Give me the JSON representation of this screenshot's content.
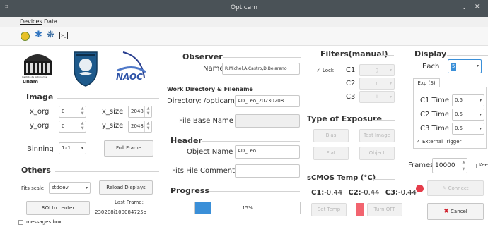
{
  "window": {
    "title": "Opticam"
  },
  "menu": {
    "devices": "Devices",
    "data": "Data"
  },
  "logos": {
    "unam": "unam",
    "unam_sub": "Instituto de Astronomía",
    "naoc": "NAOC"
  },
  "image": {
    "title": "Image",
    "x_org_label": "x_org",
    "x_org_value": "0",
    "y_org_label": "y_org",
    "y_org_value": "0",
    "x_size_label": "x_size",
    "x_size_value": "2048",
    "y_size_label": "y_size",
    "y_size_value": "2048",
    "binning_label": "Binning",
    "binning_value": "1x1",
    "full_frame_button": "Full Frame"
  },
  "others": {
    "title": "Others",
    "fits_scale_label": "Fits scale",
    "fits_scale_value": "stddev",
    "reload_button": "Reload Displays",
    "roi_button": "ROI to center",
    "last_frame_label": "Last Frame:",
    "last_frame_value": "230208i100084725o",
    "messages_box_label": "messages box"
  },
  "observer": {
    "title": "Observer",
    "name_label": "Name",
    "name_value": "R.Michel,A.Castro,D.Bejarano"
  },
  "workdir": {
    "title": "Work Directory & Filename",
    "directory_label": "Directory: /opticam/",
    "directory_value": "AD_Leo_20230208",
    "basename_label": "File Base Name",
    "basename_value": ""
  },
  "header": {
    "title": "Header",
    "object_label": "Object Name",
    "object_value": "AD_Leo",
    "comment_label": "Fits File Comment",
    "comment_value": ""
  },
  "progress": {
    "title": "Progress",
    "value": 15,
    "text": "15%"
  },
  "filters": {
    "title": "Filters(manual)",
    "lock_label": "Lock",
    "c1_label": "C1",
    "c2_label": "C2",
    "c3_label": "C3",
    "c1_value": "g",
    "c2_value": "r",
    "c3_value": "i"
  },
  "exposure": {
    "title": "Type of Exposure",
    "bias": "Bias",
    "test": "Test Image",
    "flat": "Flat",
    "object": "Object"
  },
  "temp": {
    "title": "sCMOS Temp (°C)",
    "c1_label": "C1:",
    "c1_value": "-0.44",
    "c2_label": "C2:",
    "c2_value": "-0.44",
    "c3_label": "C3:",
    "c3_value": "-0.44",
    "set_temp_button": "Set Temp",
    "turn_off_button": "Turn OFF"
  },
  "display": {
    "title": "Display",
    "each_label": "Each",
    "each_value": "5",
    "tab_label": "Exp (S)",
    "c1_time_label": "C1 Time",
    "c1_time_value": "0.5",
    "c2_time_label": "C2 Time",
    "c2_time_value": "0.5",
    "c3_time_label": "C3 Time",
    "c3_time_value": "0.5",
    "external_trigger_label": "External Trigger",
    "frames_label": "Frames",
    "frames_value": "10000",
    "keep_label": "Kee",
    "connect_button": "Connect",
    "cancel_button": "Cancel"
  },
  "colors": {
    "accent": "#3a8fd8",
    "record": "#e53c4a",
    "titlebar": "#4a5257"
  }
}
